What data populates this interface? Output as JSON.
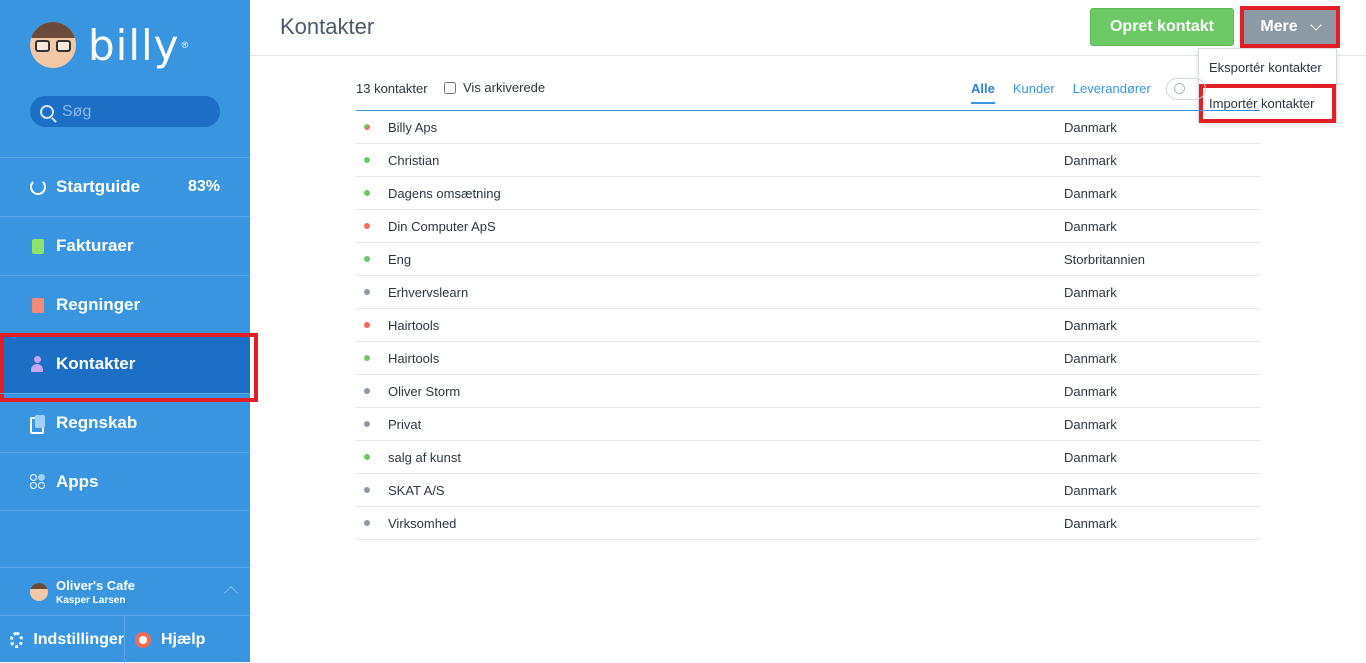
{
  "brand": {
    "name": "billy",
    "reg": "®"
  },
  "search": {
    "placeholder": "Søg"
  },
  "nav": [
    {
      "label": "Startguide",
      "value": "83%",
      "icon": "progress-ring-icon"
    },
    {
      "label": "Fakturaer",
      "icon": "invoice-icon"
    },
    {
      "label": "Regninger",
      "icon": "bill-icon"
    },
    {
      "label": "Kontakter",
      "icon": "person-icon"
    },
    {
      "label": "Regnskab",
      "icon": "ledger-icon"
    },
    {
      "label": "Apps",
      "icon": "apps-icon"
    }
  ],
  "account": {
    "company": "Oliver's Cafe",
    "user": "Kasper Larsen"
  },
  "footer": {
    "settings": "Indstillinger",
    "help": "Hjælp"
  },
  "header": {
    "title": "Kontakter",
    "create": "Opret kontakt",
    "more": "Mere"
  },
  "dropdown": {
    "export": "Eksportér kontakter",
    "import": "Importér kontakter"
  },
  "filter": {
    "count": "13 kontakter",
    "archived": "Vis arkiverede",
    "tabs": [
      "Alle",
      "Kunder",
      "Leverandører"
    ]
  },
  "colors": {
    "green": "#6dc966",
    "red": "#f26b5b",
    "gray": "#8c9aa5",
    "accent": "#3a95e0"
  },
  "contacts": [
    {
      "name": "Billy Aps",
      "country": "Danmark",
      "status": "mixed"
    },
    {
      "name": "Christian",
      "country": "Danmark",
      "status": "green"
    },
    {
      "name": "Dagens omsætning",
      "country": "Danmark",
      "status": "green"
    },
    {
      "name": "Din Computer ApS",
      "country": "Danmark",
      "status": "red"
    },
    {
      "name": "Eng",
      "country": "Storbritannien",
      "status": "green"
    },
    {
      "name": "Erhvervslearn",
      "country": "Danmark",
      "status": "gray"
    },
    {
      "name": "Hairtools",
      "country": "Danmark",
      "status": "red"
    },
    {
      "name": "Hairtools",
      "country": "Danmark",
      "status": "green"
    },
    {
      "name": "Oliver Storm",
      "country": "Danmark",
      "status": "gray"
    },
    {
      "name": "Privat",
      "country": "Danmark",
      "status": "gray"
    },
    {
      "name": "salg af kunst",
      "country": "Danmark",
      "status": "green"
    },
    {
      "name": "SKAT A/S",
      "country": "Danmark",
      "status": "gray"
    },
    {
      "name": "Virksomhed",
      "country": "Danmark",
      "status": "gray"
    }
  ]
}
